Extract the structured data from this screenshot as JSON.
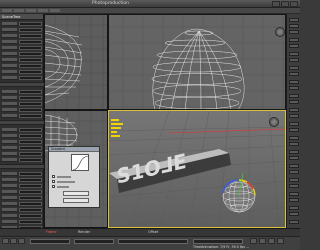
{
  "window": {
    "title": "Photoproduction"
  },
  "left_panel": {
    "header": "SceneTree"
  },
  "curve_dialog": {
    "title": "Gradient"
  },
  "timeline": {
    "labels": [
      "Frame",
      "Render",
      "Offset"
    ],
    "status_line": "TimeAnimation: 7/9 Fr, 39.5 fps   ..."
  },
  "colors": {
    "selected_viewport_border": "#d9c23a",
    "axis_red": "#e83030",
    "axis_green": "#3ad03a",
    "axis_blue": "#3a5ae8",
    "gizmo_yellow": "#f0d400"
  },
  "icons": [
    "nav-cube-icon",
    "close-icon",
    "minimize-icon",
    "maximize-icon"
  ]
}
